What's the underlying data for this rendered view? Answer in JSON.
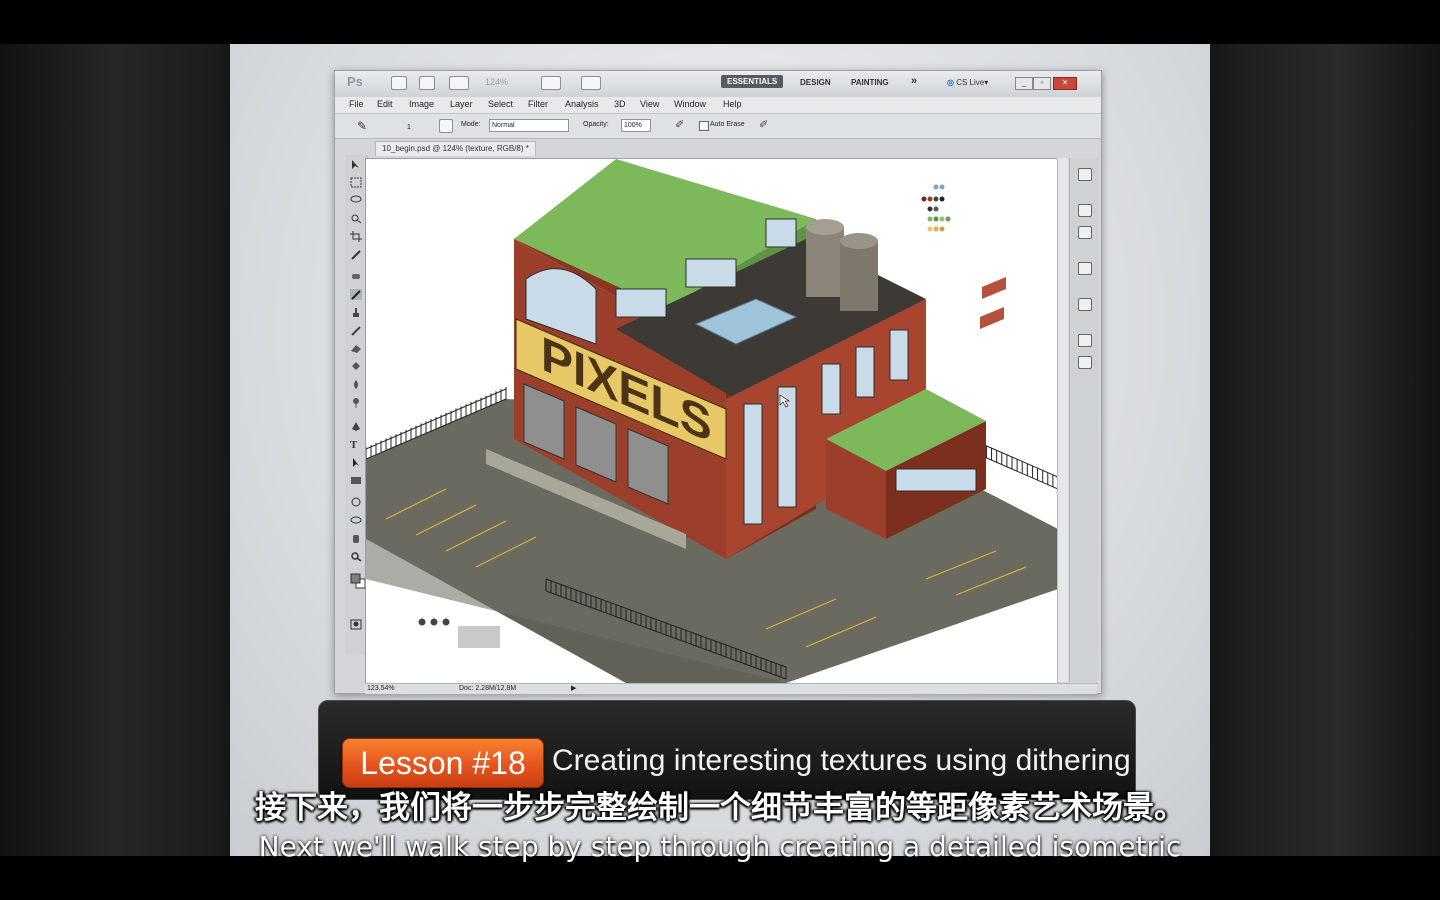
{
  "photoshop": {
    "logo": "Ps",
    "zoom": "124%",
    "workspaces": [
      "ESSENTIALS",
      "DESIGN",
      "PAINTING"
    ],
    "more": "»",
    "cs_live": "CS Live▾",
    "menu": [
      "File",
      "Edit",
      "Image",
      "Layer",
      "Select",
      "Filter",
      "Analysis",
      "3D",
      "View",
      "Window",
      "Help"
    ],
    "options": {
      "brush_size": "1",
      "mode_label": "Mode:",
      "mode_value": "Normal",
      "opacity_label": "Opacity:",
      "opacity_value": "100%",
      "auto_erase": "Auto Erase"
    },
    "document_tab": "10_begin.psd @ 124% (texture, RGB/8) *",
    "status": {
      "zoom": "123.54%",
      "doc": "Doc: 2.28M/12.8M"
    },
    "artwork_sign": "PIXELS"
  },
  "colors": {
    "roof": "#7db85a",
    "brick": "#9c3f2a",
    "sign": "#e8c766",
    "ground": "#6b6a60",
    "accent_orange": "#e5541e"
  },
  "lesson": {
    "badge": "Lesson #18",
    "title": "Creating interesting textures using dithering"
  },
  "subtitles": {
    "zh": "接下来，我们将一步步完整绘制一个细节丰富的等距像素艺术场景。",
    "en": "Next we'll walk step by step through creating a detailed isometric"
  }
}
